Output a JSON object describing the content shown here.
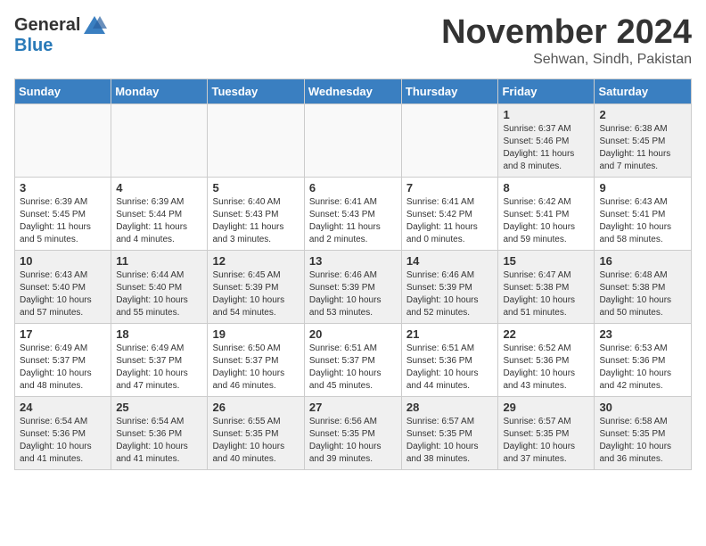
{
  "logo": {
    "general": "General",
    "blue": "Blue"
  },
  "title": "November 2024",
  "location": "Sehwan, Sindh, Pakistan",
  "days_of_week": [
    "Sunday",
    "Monday",
    "Tuesday",
    "Wednesday",
    "Thursday",
    "Friday",
    "Saturday"
  ],
  "weeks": [
    [
      {
        "day": "",
        "empty": true
      },
      {
        "day": "",
        "empty": true
      },
      {
        "day": "",
        "empty": true
      },
      {
        "day": "",
        "empty": true
      },
      {
        "day": "",
        "empty": true
      },
      {
        "day": "1",
        "sunrise": "Sunrise: 6:37 AM",
        "sunset": "Sunset: 5:46 PM",
        "daylight": "Daylight: 11 hours and 8 minutes."
      },
      {
        "day": "2",
        "sunrise": "Sunrise: 6:38 AM",
        "sunset": "Sunset: 5:45 PM",
        "daylight": "Daylight: 11 hours and 7 minutes."
      }
    ],
    [
      {
        "day": "3",
        "sunrise": "Sunrise: 6:39 AM",
        "sunset": "Sunset: 5:45 PM",
        "daylight": "Daylight: 11 hours and 5 minutes."
      },
      {
        "day": "4",
        "sunrise": "Sunrise: 6:39 AM",
        "sunset": "Sunset: 5:44 PM",
        "daylight": "Daylight: 11 hours and 4 minutes."
      },
      {
        "day": "5",
        "sunrise": "Sunrise: 6:40 AM",
        "sunset": "Sunset: 5:43 PM",
        "daylight": "Daylight: 11 hours and 3 minutes."
      },
      {
        "day": "6",
        "sunrise": "Sunrise: 6:41 AM",
        "sunset": "Sunset: 5:43 PM",
        "daylight": "Daylight: 11 hours and 2 minutes."
      },
      {
        "day": "7",
        "sunrise": "Sunrise: 6:41 AM",
        "sunset": "Sunset: 5:42 PM",
        "daylight": "Daylight: 11 hours and 0 minutes."
      },
      {
        "day": "8",
        "sunrise": "Sunrise: 6:42 AM",
        "sunset": "Sunset: 5:41 PM",
        "daylight": "Daylight: 10 hours and 59 minutes."
      },
      {
        "day": "9",
        "sunrise": "Sunrise: 6:43 AM",
        "sunset": "Sunset: 5:41 PM",
        "daylight": "Daylight: 10 hours and 58 minutes."
      }
    ],
    [
      {
        "day": "10",
        "sunrise": "Sunrise: 6:43 AM",
        "sunset": "Sunset: 5:40 PM",
        "daylight": "Daylight: 10 hours and 57 minutes."
      },
      {
        "day": "11",
        "sunrise": "Sunrise: 6:44 AM",
        "sunset": "Sunset: 5:40 PM",
        "daylight": "Daylight: 10 hours and 55 minutes."
      },
      {
        "day": "12",
        "sunrise": "Sunrise: 6:45 AM",
        "sunset": "Sunset: 5:39 PM",
        "daylight": "Daylight: 10 hours and 54 minutes."
      },
      {
        "day": "13",
        "sunrise": "Sunrise: 6:46 AM",
        "sunset": "Sunset: 5:39 PM",
        "daylight": "Daylight: 10 hours and 53 minutes."
      },
      {
        "day": "14",
        "sunrise": "Sunrise: 6:46 AM",
        "sunset": "Sunset: 5:39 PM",
        "daylight": "Daylight: 10 hours and 52 minutes."
      },
      {
        "day": "15",
        "sunrise": "Sunrise: 6:47 AM",
        "sunset": "Sunset: 5:38 PM",
        "daylight": "Daylight: 10 hours and 51 minutes."
      },
      {
        "day": "16",
        "sunrise": "Sunrise: 6:48 AM",
        "sunset": "Sunset: 5:38 PM",
        "daylight": "Daylight: 10 hours and 50 minutes."
      }
    ],
    [
      {
        "day": "17",
        "sunrise": "Sunrise: 6:49 AM",
        "sunset": "Sunset: 5:37 PM",
        "daylight": "Daylight: 10 hours and 48 minutes."
      },
      {
        "day": "18",
        "sunrise": "Sunrise: 6:49 AM",
        "sunset": "Sunset: 5:37 PM",
        "daylight": "Daylight: 10 hours and 47 minutes."
      },
      {
        "day": "19",
        "sunrise": "Sunrise: 6:50 AM",
        "sunset": "Sunset: 5:37 PM",
        "daylight": "Daylight: 10 hours and 46 minutes."
      },
      {
        "day": "20",
        "sunrise": "Sunrise: 6:51 AM",
        "sunset": "Sunset: 5:37 PM",
        "daylight": "Daylight: 10 hours and 45 minutes."
      },
      {
        "day": "21",
        "sunrise": "Sunrise: 6:51 AM",
        "sunset": "Sunset: 5:36 PM",
        "daylight": "Daylight: 10 hours and 44 minutes."
      },
      {
        "day": "22",
        "sunrise": "Sunrise: 6:52 AM",
        "sunset": "Sunset: 5:36 PM",
        "daylight": "Daylight: 10 hours and 43 minutes."
      },
      {
        "day": "23",
        "sunrise": "Sunrise: 6:53 AM",
        "sunset": "Sunset: 5:36 PM",
        "daylight": "Daylight: 10 hours and 42 minutes."
      }
    ],
    [
      {
        "day": "24",
        "sunrise": "Sunrise: 6:54 AM",
        "sunset": "Sunset: 5:36 PM",
        "daylight": "Daylight: 10 hours and 41 minutes."
      },
      {
        "day": "25",
        "sunrise": "Sunrise: 6:54 AM",
        "sunset": "Sunset: 5:36 PM",
        "daylight": "Daylight: 10 hours and 41 minutes."
      },
      {
        "day": "26",
        "sunrise": "Sunrise: 6:55 AM",
        "sunset": "Sunset: 5:35 PM",
        "daylight": "Daylight: 10 hours and 40 minutes."
      },
      {
        "day": "27",
        "sunrise": "Sunrise: 6:56 AM",
        "sunset": "Sunset: 5:35 PM",
        "daylight": "Daylight: 10 hours and 39 minutes."
      },
      {
        "day": "28",
        "sunrise": "Sunrise: 6:57 AM",
        "sunset": "Sunset: 5:35 PM",
        "daylight": "Daylight: 10 hours and 38 minutes."
      },
      {
        "day": "29",
        "sunrise": "Sunrise: 6:57 AM",
        "sunset": "Sunset: 5:35 PM",
        "daylight": "Daylight: 10 hours and 37 minutes."
      },
      {
        "day": "30",
        "sunrise": "Sunrise: 6:58 AM",
        "sunset": "Sunset: 5:35 PM",
        "daylight": "Daylight: 10 hours and 36 minutes."
      }
    ]
  ]
}
